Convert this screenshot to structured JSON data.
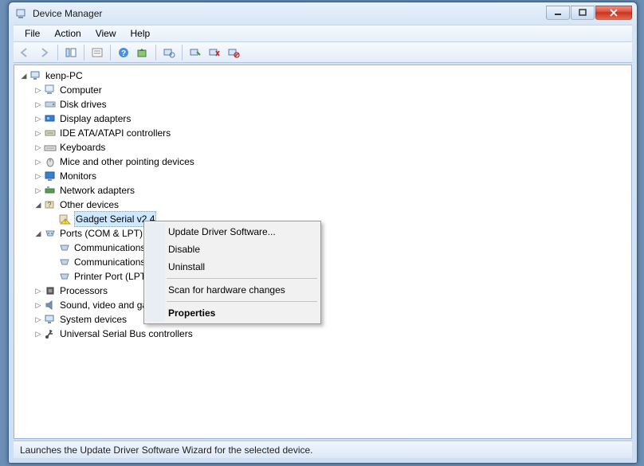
{
  "window": {
    "title": "Device Manager"
  },
  "menu": {
    "file": "File",
    "action": "Action",
    "view": "View",
    "help": "Help"
  },
  "root": {
    "label": "kenp-PC"
  },
  "cats": {
    "computer": "Computer",
    "disk": "Disk drives",
    "display": "Display adapters",
    "ide": "IDE ATA/ATAPI controllers",
    "keyboards": "Keyboards",
    "mice": "Mice and other pointing devices",
    "monitors": "Monitors",
    "network": "Network adapters",
    "other": "Other devices",
    "gadget": "Gadget Serial v2.4",
    "ports": "Ports (COM & LPT)",
    "com1": "Communications Port (COM1)",
    "com2": "Communications Port (COM2)",
    "lpt": "Printer Port (LPT1)",
    "processors": "Processors",
    "sound": "Sound, video and game controllers",
    "system": "System devices",
    "usb": "Universal Serial Bus controllers"
  },
  "ctx": {
    "update": "Update Driver Software...",
    "disable": "Disable",
    "uninstall": "Uninstall",
    "scan": "Scan for hardware changes",
    "properties": "Properties"
  },
  "status": "Launches the Update Driver Software Wizard for the selected device."
}
